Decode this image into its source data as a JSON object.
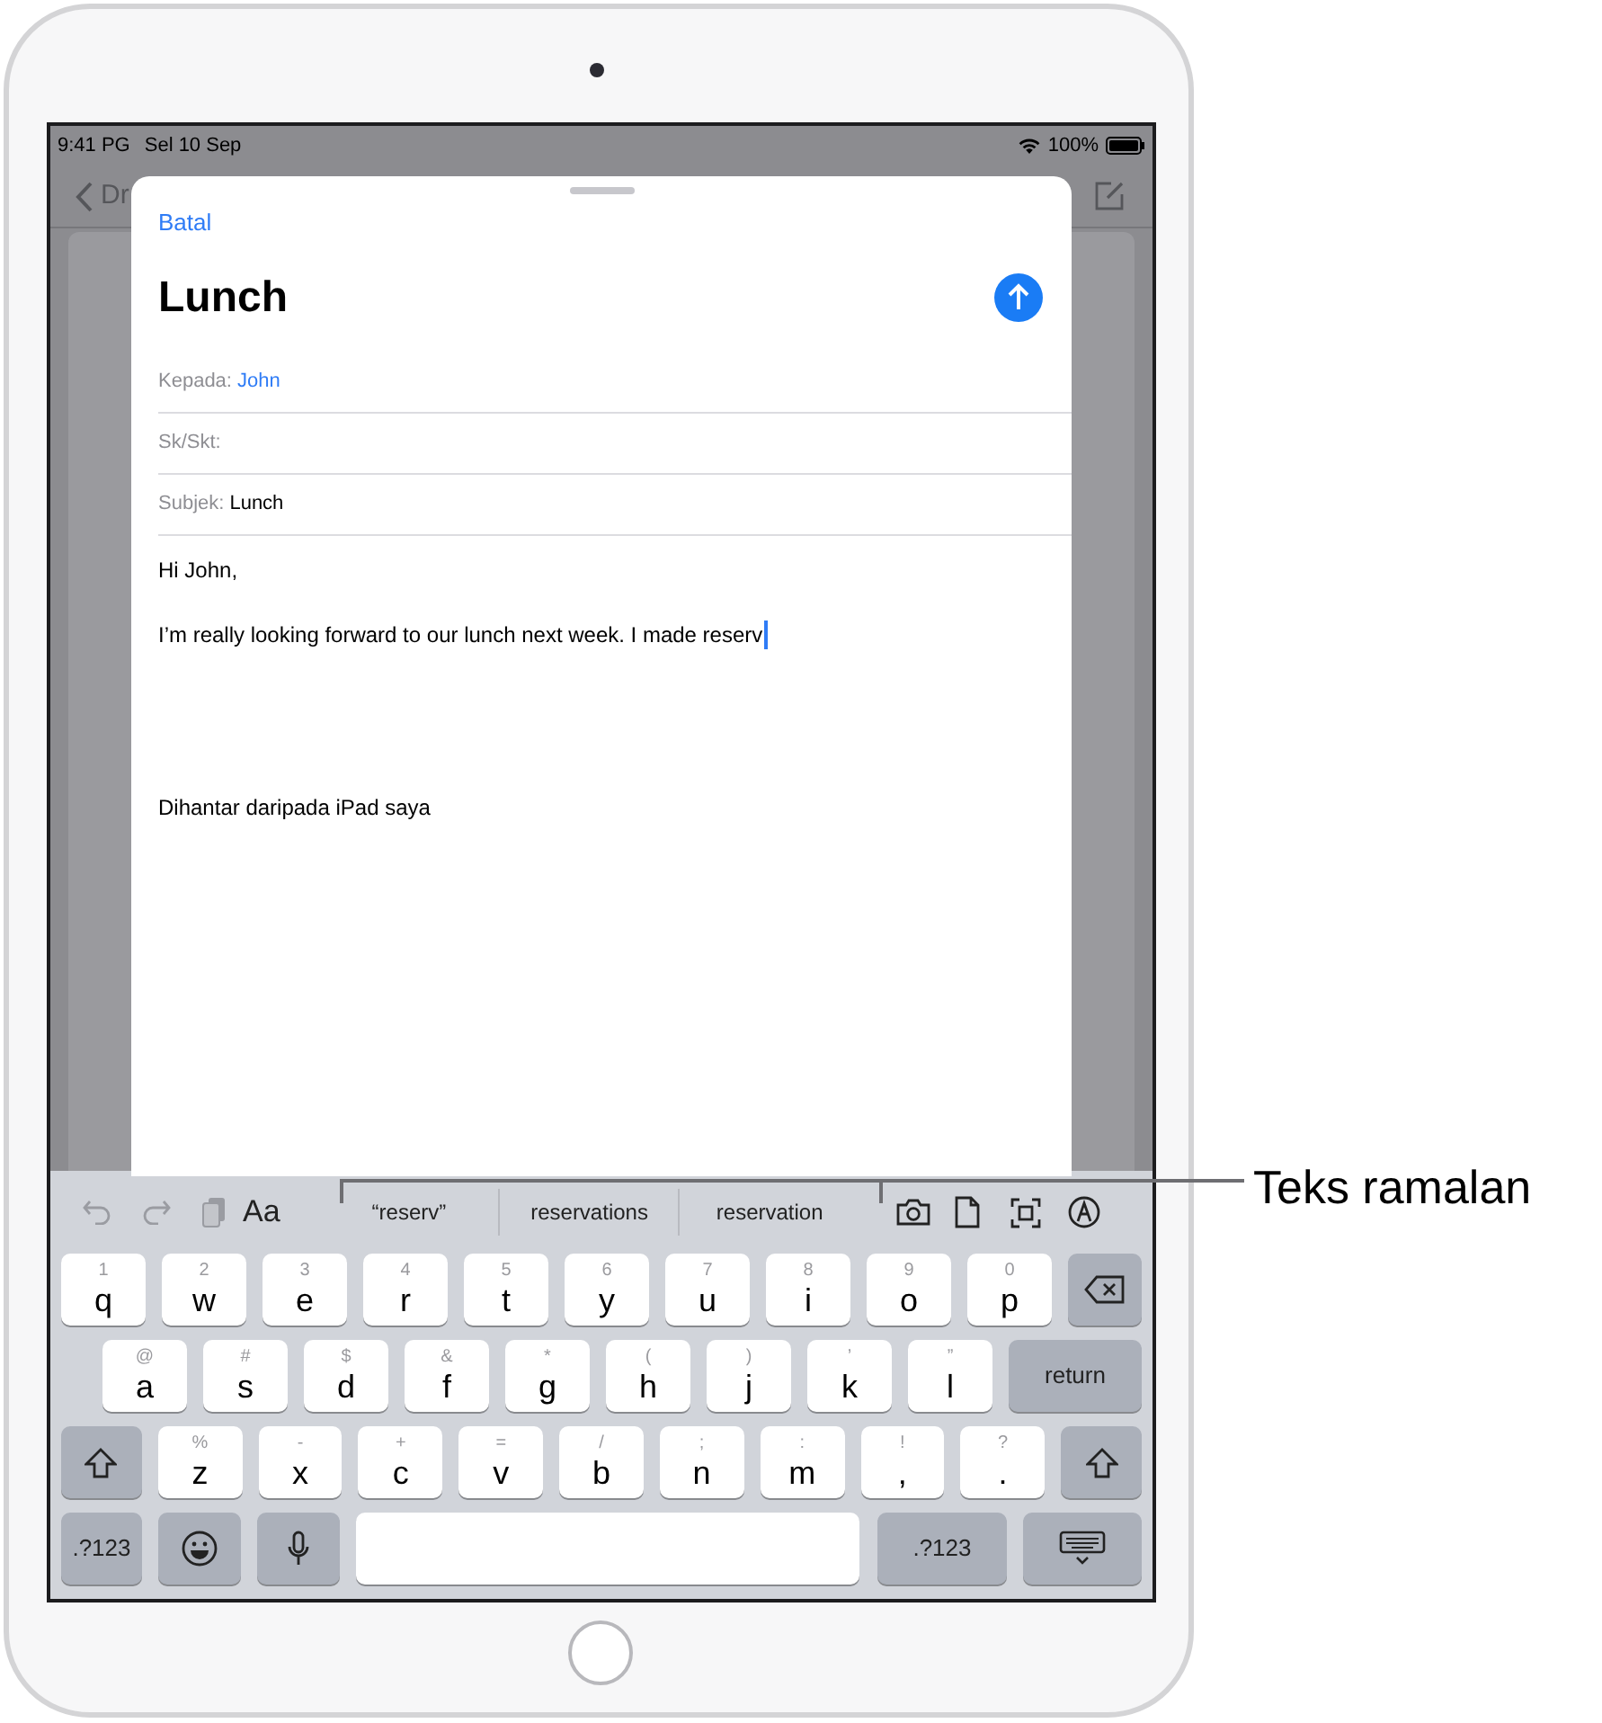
{
  "status_bar": {
    "time": "9:41 PG",
    "date": "Sel 10 Sep",
    "battery": "100%"
  },
  "background_nav": {
    "back_label": "Dr"
  },
  "compose": {
    "cancel": "Batal",
    "title": "Lunch",
    "fields": [
      {
        "kind": "recipient",
        "label": "Kepada:",
        "value": "John"
      },
      {
        "kind": "empty",
        "label": "Sk/Skt:"
      },
      {
        "kind": "text",
        "label": "Subjek:",
        "value": "Lunch"
      }
    ],
    "body": [
      {
        "kind": "line",
        "text": "Hi John,"
      },
      {
        "kind": "typing",
        "text": "I’m really looking forward to our lunch next week. I made reserv"
      },
      {
        "kind": "signature",
        "text": "Dihantar daripada iPad saya"
      }
    ]
  },
  "keyboard": {
    "format_label": "Aa",
    "predictions": [
      {
        "text": "“reserv”"
      },
      {
        "text": "reservations"
      },
      {
        "text": "reservation"
      }
    ],
    "rows": [
      [
        {
          "kind": "letter",
          "main": "q",
          "alt": "1"
        },
        {
          "kind": "letter",
          "main": "w",
          "alt": "2"
        },
        {
          "kind": "letter",
          "main": "e",
          "alt": "3"
        },
        {
          "kind": "letter",
          "main": "r",
          "alt": "4"
        },
        {
          "kind": "letter",
          "main": "t",
          "alt": "5"
        },
        {
          "kind": "letter",
          "main": "y",
          "alt": "6"
        },
        {
          "kind": "letter",
          "main": "u",
          "alt": "7"
        },
        {
          "kind": "letter",
          "main": "i",
          "alt": "8"
        },
        {
          "kind": "letter",
          "main": "o",
          "alt": "9"
        },
        {
          "kind": "letter",
          "main": "p",
          "alt": "0"
        },
        {
          "kind": "delete"
        }
      ],
      [
        {
          "kind": "letter",
          "main": "a",
          "alt": "@"
        },
        {
          "kind": "letter",
          "main": "s",
          "alt": "#"
        },
        {
          "kind": "letter",
          "main": "d",
          "alt": "$"
        },
        {
          "kind": "letter",
          "main": "f",
          "alt": "&"
        },
        {
          "kind": "letter",
          "main": "g",
          "alt": "*"
        },
        {
          "kind": "letter",
          "main": "h",
          "alt": "("
        },
        {
          "kind": "letter",
          "main": "j",
          "alt": ")"
        },
        {
          "kind": "letter",
          "main": "k",
          "alt": "’"
        },
        {
          "kind": "letter",
          "main": "l",
          "alt": "”"
        },
        {
          "kind": "return",
          "label": "return"
        }
      ],
      [
        {
          "kind": "shift"
        },
        {
          "kind": "letter",
          "main": "z",
          "alt": "%"
        },
        {
          "kind": "letter",
          "main": "x",
          "alt": "-"
        },
        {
          "kind": "letter",
          "main": "c",
          "alt": "+"
        },
        {
          "kind": "letter",
          "main": "v",
          "alt": "="
        },
        {
          "kind": "letter",
          "main": "b",
          "alt": "/"
        },
        {
          "kind": "letter",
          "main": "n",
          "alt": ";"
        },
        {
          "kind": "letter",
          "main": "m",
          "alt": ":"
        },
        {
          "kind": "letter",
          "main": ",",
          "alt": "!"
        },
        {
          "kind": "letter",
          "main": ".",
          "alt": "?"
        },
        {
          "kind": "shift"
        }
      ],
      [
        {
          "kind": "numbers",
          "label": ".?123"
        },
        {
          "kind": "emoji"
        },
        {
          "kind": "mic"
        },
        {
          "kind": "space"
        },
        {
          "kind": "numbers",
          "label": ".?123"
        },
        {
          "kind": "hide"
        }
      ]
    ]
  },
  "callout": {
    "label": "Teks ramalan"
  }
}
